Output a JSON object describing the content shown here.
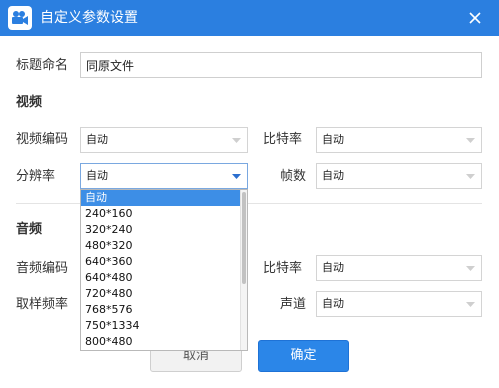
{
  "window": {
    "title": "自定义参数设置",
    "icons": {
      "app": "video-camera-icon",
      "close": "close-icon",
      "dropdown": "caret-down-icon"
    },
    "colors": {
      "titlebar": "#2b7fe0",
      "primary_button": "#2b86e8",
      "selected_item": "#3d8ee6"
    }
  },
  "title_field": {
    "label": "标题命名",
    "value": "同原文件"
  },
  "video": {
    "section_label": "视频",
    "codec": {
      "label": "视频编码",
      "value": "自动"
    },
    "bitrate": {
      "label": "比特率",
      "value": "自动"
    },
    "resolution": {
      "label": "分辨率",
      "value": "自动"
    },
    "framerate": {
      "label": "帧数",
      "value": "自动"
    }
  },
  "audio": {
    "section_label": "音频",
    "codec": {
      "label": "音频编码"
    },
    "bitrate": {
      "label": "比特率",
      "value": "自动"
    },
    "samplerate": {
      "label": "取样频率"
    },
    "channels": {
      "label": "声道",
      "value": "自动"
    }
  },
  "resolution_options": [
    "自动",
    "240*160",
    "320*240",
    "480*320",
    "640*360",
    "640*480",
    "720*480",
    "768*576",
    "750*1334",
    "800*480"
  ],
  "buttons": {
    "cancel": "取消",
    "ok": "确定"
  }
}
